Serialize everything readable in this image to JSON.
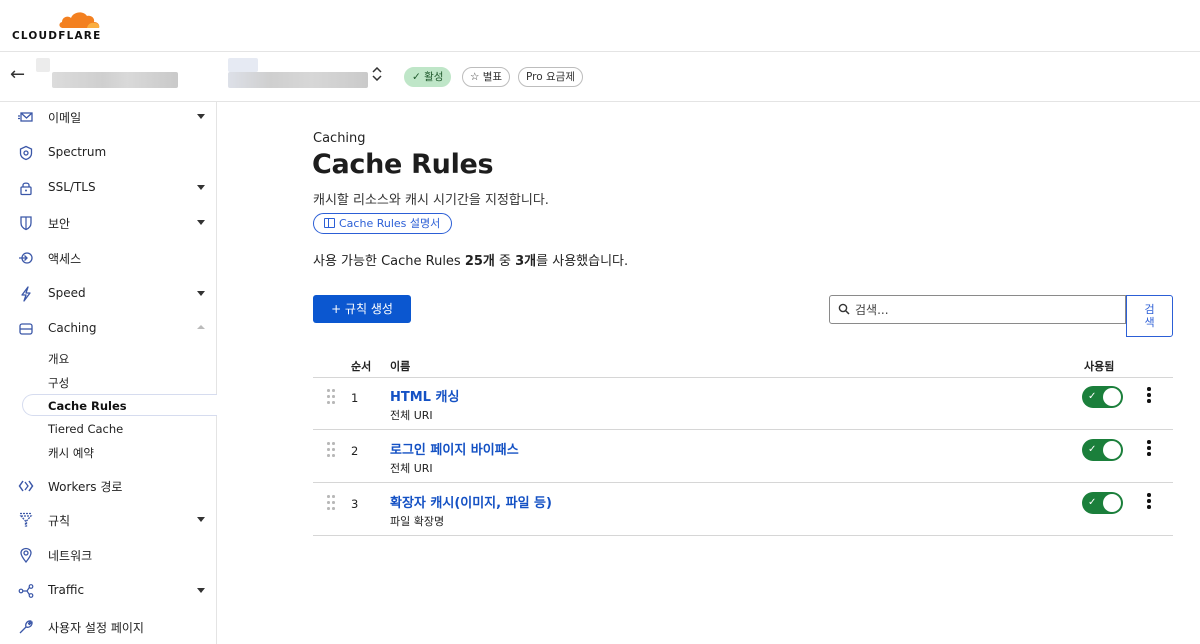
{
  "brand": {
    "name": "CLOUDFLARE",
    "accent": "#f38020"
  },
  "zone": {
    "status": "활성",
    "star": "별표",
    "plan": "Pro 요금제"
  },
  "sidebar": {
    "items": [
      {
        "label": "이메일",
        "icon": "email-icon",
        "expandable": true
      },
      {
        "label": "Spectrum",
        "icon": "spectrum-icon",
        "expandable": false
      },
      {
        "label": "SSL/TLS",
        "icon": "lock-icon",
        "expandable": true
      },
      {
        "label": "보안",
        "icon": "shield-icon",
        "expandable": true
      },
      {
        "label": "액세스",
        "icon": "access-icon",
        "expandable": false
      },
      {
        "label": "Speed",
        "icon": "lightning-icon",
        "expandable": true
      },
      {
        "label": "Caching",
        "icon": "storage-icon",
        "expandable": true,
        "expanded": true
      }
    ],
    "caching_sub": [
      "개요",
      "구성",
      "Cache Rules",
      "Tiered Cache",
      "캐시 예약"
    ],
    "items_after": [
      {
        "label": "Workers 경로",
        "icon": "workers-icon",
        "expandable": false
      },
      {
        "label": "규칙",
        "icon": "rules-icon",
        "expandable": true
      },
      {
        "label": "네트워크",
        "icon": "location-icon",
        "expandable": false
      },
      {
        "label": "Traffic",
        "icon": "traffic-icon",
        "expandable": true
      },
      {
        "label": "사용자 설정 페이지",
        "icon": "wrench-icon",
        "expandable": false
      }
    ]
  },
  "main": {
    "breadcrumb": "Caching",
    "title": "Cache Rules",
    "description": "캐시할 리소스와 캐시 시기간을 지정합니다.",
    "doc_button": "Cache Rules 설명서",
    "usage": {
      "prefix": "사용 가능한 Cache Rules ",
      "total": "25개",
      "mid": " 중 ",
      "used": "3개",
      "suffix": "를 사용했습니다."
    },
    "create_button": "+  규칙 생성",
    "search_placeholder": "검색...",
    "search_button": "검색",
    "table": {
      "headers": {
        "order": "순서",
        "name": "이름",
        "enabled": "사용됨"
      },
      "rows": [
        {
          "order": "1",
          "name": "HTML 캐싱",
          "sub": "전체 URI",
          "enabled": true
        },
        {
          "order": "2",
          "name": "로그인 페이지 바이패스",
          "sub": "전체 URI",
          "enabled": true
        },
        {
          "order": "3",
          "name": "확장자 캐시(이미지, 파일 등)",
          "sub": "파일 확장명",
          "enabled": true
        }
      ]
    }
  }
}
